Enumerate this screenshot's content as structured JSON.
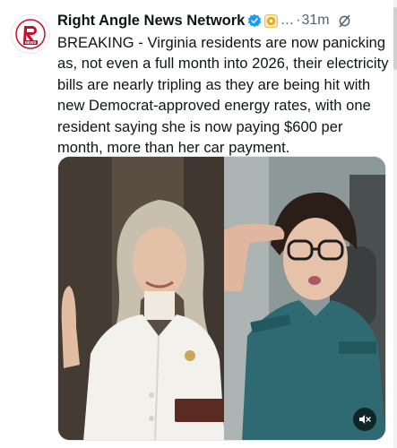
{
  "tweet": {
    "author": {
      "display_name": "Right Angle News Network",
      "avatar_text": "RA",
      "avatar_subtext": "NEWS"
    },
    "header": {
      "ellipsis": "...",
      "separator": "·",
      "time": "31m"
    },
    "text": "BREAKING - Virginia residents are now panicking as, not even a full month into 2026, their electricity bills are nearly tripling as they are being hit with new Democrat-approved energy rates, with one resident saying she is now paying $600 per month, more than her car payment."
  },
  "icons": {
    "verified": "verified-badge-icon",
    "affiliate": "affiliate-badge-icon",
    "grok": "grok-icon",
    "mute": "mute-icon"
  },
  "colors": {
    "text": "#0f1419",
    "muted": "#536471",
    "verified": "#1d9bf0",
    "brand_red": "#c8102e"
  }
}
